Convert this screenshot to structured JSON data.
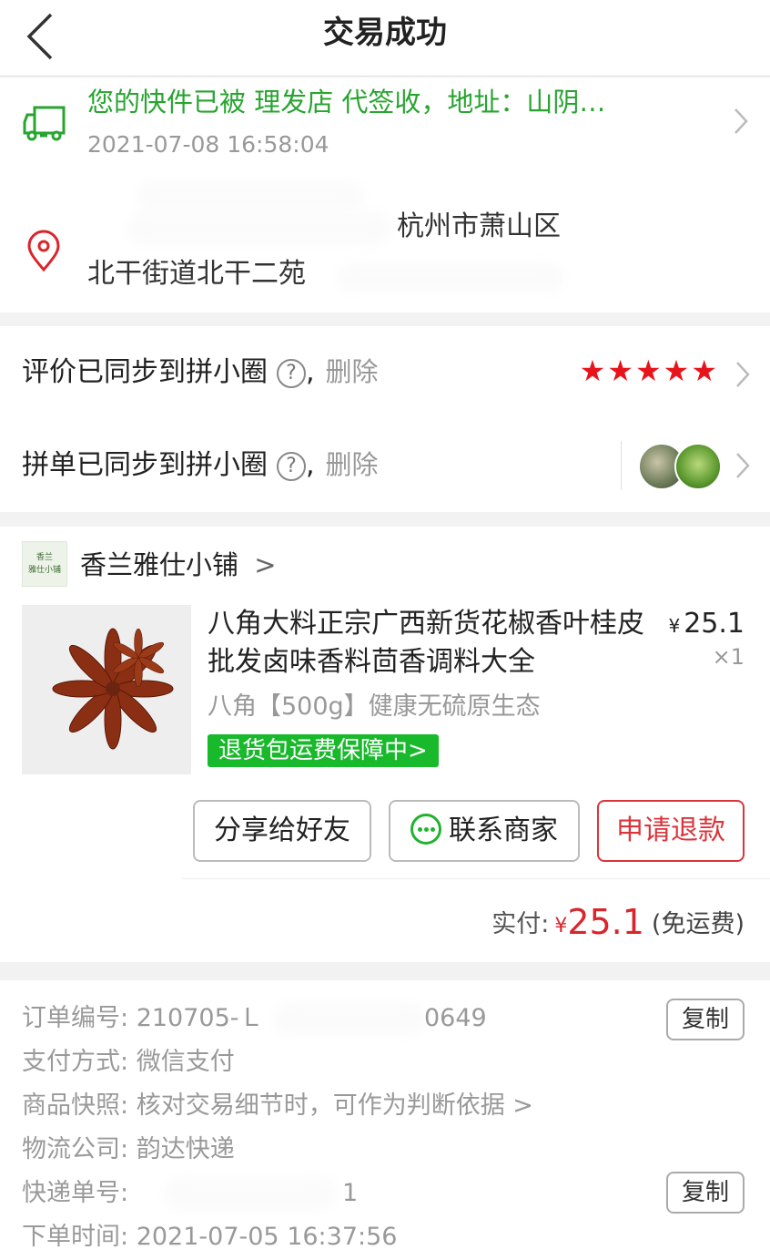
{
  "header": {
    "title": "交易成功",
    "back_icon": "chevron-left-icon"
  },
  "logistics": {
    "message": "您的快件已被 理发店 代签收，地址：山阴…",
    "time": "2021-07-08 16:58:04",
    "address_line1": "杭州市萧山区",
    "address_line2": "北干街道北干二苑",
    "accent_color": "#27a52f"
  },
  "sync": {
    "review": {
      "label": "评价已同步到拼小圈",
      "help": "?",
      "comma": ",",
      "delete": "删除",
      "stars": 5
    },
    "order": {
      "label": "拼单已同步到拼小圈",
      "help": "?",
      "comma": ",",
      "delete": "删除"
    }
  },
  "order": {
    "shop_logo_text1": "香兰",
    "shop_logo_text2": "雅仕小铺",
    "shop_name": "香兰雅仕小铺",
    "shop_chevron": ">",
    "title": "八角大料正宗广西新货花椒香叶桂皮批发卤味香料茴香调料大全",
    "price_symbol": "¥",
    "price": "25.1",
    "quantity": "×1",
    "spec": "八角【500g】健康无硫原生态",
    "return_badge": "退货包运费保障中>",
    "buttons": {
      "share": "分享给好友",
      "contact": "联系商家",
      "refund": "申请退款"
    },
    "paid_label": "实付:",
    "paid_symbol": "¥",
    "paid_amount": "25.1",
    "paid_note": "(免运费)",
    "price_color": "#d9262c"
  },
  "details": {
    "order_no_label": "订单编号:",
    "order_no_value": "210705-Ｌ",
    "order_no_tail": "0649",
    "payment_label": "支付方式:",
    "payment_value": "微信支付",
    "snapshot_label": "商品快照:",
    "snapshot_value": "核对交易细节时，可作为判断依据 >",
    "courier_label": "物流公司:",
    "courier_value": "韵达快递",
    "tracking_label": "快递单号:",
    "tracking_value": "1",
    "order_time_label": "下单时间:",
    "order_time_value": "2021-07-05 16:37:56",
    "copy_label": "复制"
  }
}
